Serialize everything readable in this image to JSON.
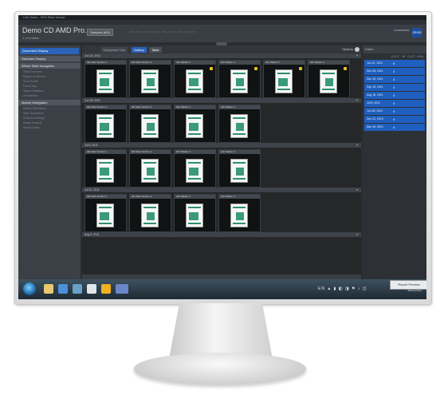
{
  "window": {
    "title": "Carl Zeiss - ZEN Slide Viewer",
    "menus": [
      "Application",
      "Options",
      "Window",
      "Help"
    ]
  },
  "header": {
    "project": "Demo CD AMD Pro...",
    "project_sub": "1 of 6 slides",
    "sample_button": "Samples (6/6)",
    "tabs": "Slides   Images   Report   Analysis",
    "right_status": "connected",
    "logo": "ZEISS"
  },
  "sidebar": {
    "active": "Document Display",
    "sections": [
      {
        "title": "Standard Display",
        "items": []
      },
      {
        "title": "Whole Slide Navigation",
        "items": [
          "Slide Overview",
          "Region of Interest",
          "Scan Profile",
          "Focus Map",
          "Tissue Detection",
          "Annotations"
        ]
      },
      {
        "title": "Marker Navigation",
        "items": [
          "Marker Definitions",
          "Stain Separation",
          "Channel Settings",
          "Image Analysis",
          "Report Setup"
        ]
      }
    ]
  },
  "viewbar": {
    "b1": "Document Tree",
    "b2": "Gallery",
    "b3": "Table",
    "right": "Options"
  },
  "groups": [
    {
      "date": "Jun 21, 2011",
      "tiles": [
        "HE Stain Section 1",
        "HE Stain Section 2",
        "IHC Marker 3",
        "IHC Marker 4",
        "IHC Marker 5",
        "IHC Marker 6"
      ]
    },
    {
      "date": "Jun 28, 2011",
      "tiles": [
        "HE Stain Section 1",
        "HE Stain Section 2",
        "IHC Marker 3",
        "IHC Marker 4"
      ]
    },
    {
      "date": "Jul 5, 2011",
      "tiles": [
        "HE Stain Section 1",
        "HE Stain Section 2",
        "IHC Marker 3",
        "IHC Marker 4"
      ]
    },
    {
      "date": "Jul 12, 2011",
      "tiles": [
        "HE Stain Section 1",
        "HE Stain Section 2",
        "IHC Marker 3",
        "IHC Marker 4"
      ]
    },
    {
      "date": "Aug 5, 2011",
      "tiles": []
    }
  ],
  "right_panel": {
    "title": "Dates",
    "columns": "DOC  IN  OUT  ANL",
    "rows": [
      {
        "date": "Jun 21, 2011",
        "count": "6"
      },
      {
        "date": "Nov 28, 2011",
        "count": "4"
      },
      {
        "date": "Dec 16, 2011",
        "count": "4"
      },
      {
        "date": "Sep 16, 2011",
        "count": "4"
      },
      {
        "date": "Aug 16, 2011",
        "count": "4"
      },
      {
        "date": "Jul 8, 2011",
        "count": "4"
      },
      {
        "date": "Jun 28, 2011",
        "count": "4"
      },
      {
        "date": "Dec 22, 2010",
        "count": "4"
      },
      {
        "date": "Mar 18, 2010",
        "count": "4"
      }
    ]
  },
  "taskbar": {
    "tray": "EN ▲ ▮ ◧ ◨ ⚑ ♪ ◫",
    "time": "10:07",
    "date": "8/21/2011",
    "popup": "Report Preview"
  }
}
